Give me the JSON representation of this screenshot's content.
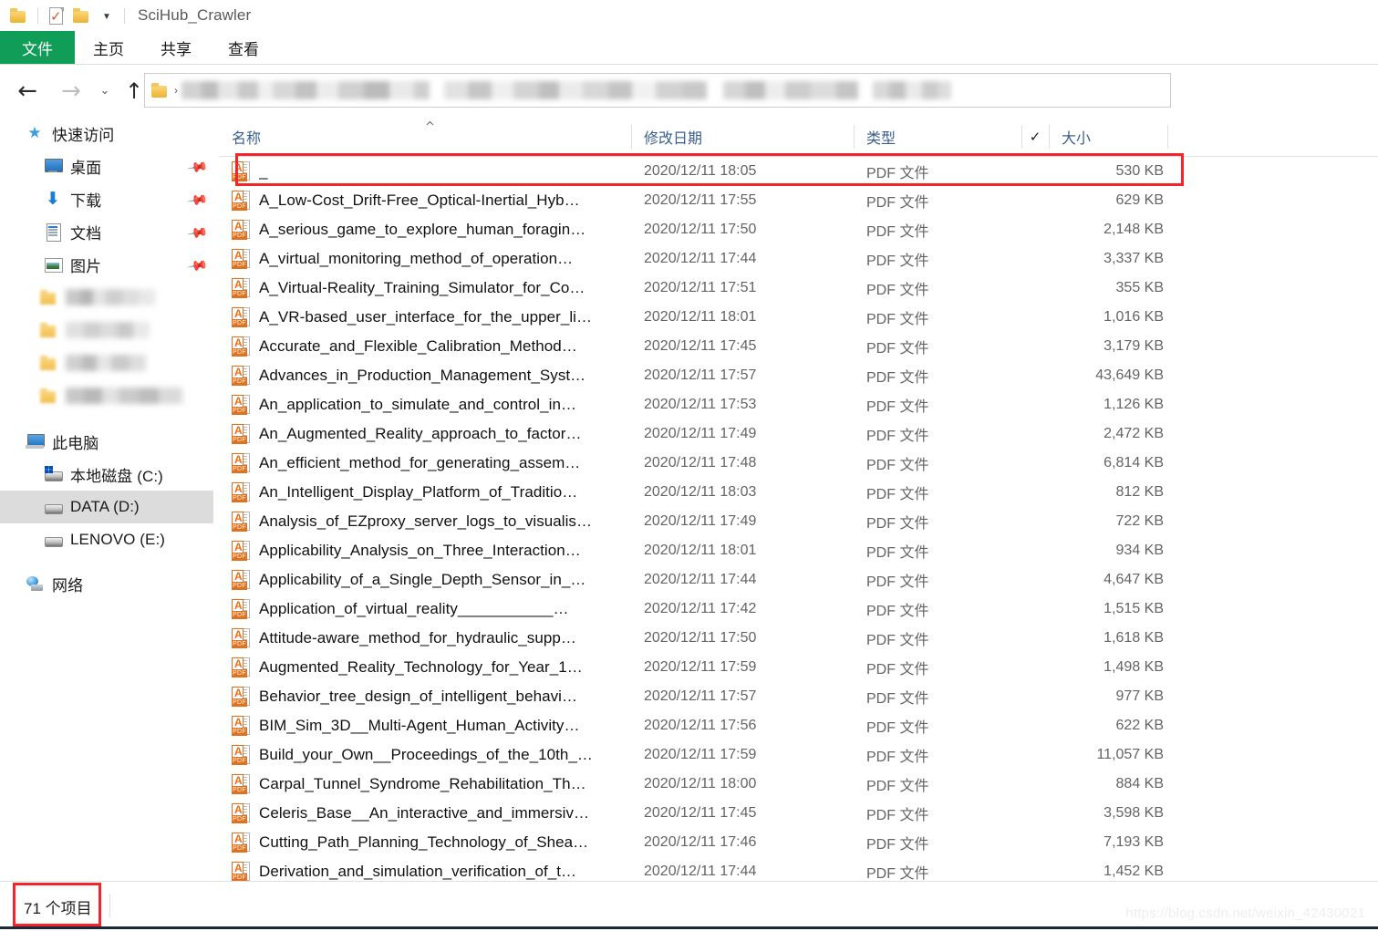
{
  "window": {
    "title": "SciHub_Crawler",
    "quick_access_toolbar": [
      {
        "name": "folder-icon",
        "label": ""
      },
      {
        "name": "properties-icon",
        "label": ""
      },
      {
        "name": "new-folder-icon",
        "label": ""
      },
      {
        "name": "customize-caret-icon",
        "label": "▼"
      }
    ]
  },
  "ribbon": {
    "tabs": [
      {
        "label": "文件",
        "active": true
      },
      {
        "label": "主页",
        "active": false
      },
      {
        "label": "共享",
        "active": false
      },
      {
        "label": "查看",
        "active": false
      }
    ]
  },
  "nav": {
    "back": "←",
    "forward": "→",
    "recent": "⌄",
    "up": "↑",
    "address_chevron": "›",
    "address_redacted": true
  },
  "sidebar": {
    "quick_access": {
      "label": "快速访问"
    },
    "pinned": [
      {
        "label": "桌面",
        "icon": "desktop-icon",
        "pinned": true
      },
      {
        "label": "下载",
        "icon": "download-icon",
        "pinned": true
      },
      {
        "label": "文档",
        "icon": "documents-icon",
        "pinned": true
      },
      {
        "label": "图片",
        "icon": "pictures-icon",
        "pinned": true
      }
    ],
    "redacted_folders": 4,
    "this_pc": {
      "label": "此电脑"
    },
    "drives": [
      {
        "label": "本地磁盘 (C:)",
        "selected": false
      },
      {
        "label": "DATA (D:)",
        "selected": true
      },
      {
        "label": "LENOVO (E:)",
        "selected": false
      }
    ],
    "network": {
      "label": "网络"
    }
  },
  "columns": {
    "name": "名称",
    "date_modified": "修改日期",
    "type": "类型",
    "checkmark": "✓",
    "size": "大小",
    "sort_indicator": "^"
  },
  "files": [
    {
      "name": "_",
      "date": "2020/12/11 18:05",
      "type": "PDF 文件",
      "size": "530 KB",
      "highlighted": true
    },
    {
      "name": "A_Low-Cost_Drift-Free_Optical-Inertial_Hyb…",
      "date": "2020/12/11 17:55",
      "type": "PDF 文件",
      "size": "629 KB",
      "highlighted": false
    },
    {
      "name": "A_serious_game_to_explore_human_foragin…",
      "date": "2020/12/11 17:50",
      "type": "PDF 文件",
      "size": "2,148 KB",
      "highlighted": false
    },
    {
      "name": "A_virtual_monitoring_method_of_operation…",
      "date": "2020/12/11 17:44",
      "type": "PDF 文件",
      "size": "3,337 KB",
      "highlighted": false
    },
    {
      "name": "A_Virtual-Reality_Training_Simulator_for_Co…",
      "date": "2020/12/11 17:51",
      "type": "PDF 文件",
      "size": "355 KB",
      "highlighted": false
    },
    {
      "name": "A_VR-based_user_interface_for_the_upper_li…",
      "date": "2020/12/11 18:01",
      "type": "PDF 文件",
      "size": "1,016 KB",
      "highlighted": false
    },
    {
      "name": "Accurate_and_Flexible_Calibration_Method…",
      "date": "2020/12/11 17:45",
      "type": "PDF 文件",
      "size": "3,179 KB",
      "highlighted": false
    },
    {
      "name": "Advances_in_Production_Management_Syst…",
      "date": "2020/12/11 17:57",
      "type": "PDF 文件",
      "size": "43,649 KB",
      "highlighted": false
    },
    {
      "name": "An_application_to_simulate_and_control_in…",
      "date": "2020/12/11 17:53",
      "type": "PDF 文件",
      "size": "1,126 KB",
      "highlighted": false
    },
    {
      "name": "An_Augmented_Reality_approach_to_factor…",
      "date": "2020/12/11 17:49",
      "type": "PDF 文件",
      "size": "2,472 KB",
      "highlighted": false
    },
    {
      "name": "An_efficient_method_for_generating_assem…",
      "date": "2020/12/11 17:48",
      "type": "PDF 文件",
      "size": "6,814 KB",
      "highlighted": false
    },
    {
      "name": "An_Intelligent_Display_Platform_of_Traditio…",
      "date": "2020/12/11 18:03",
      "type": "PDF 文件",
      "size": "812 KB",
      "highlighted": false
    },
    {
      "name": "Analysis_of_EZproxy_server_logs_to_visualis…",
      "date": "2020/12/11 17:49",
      "type": "PDF 文件",
      "size": "722 KB",
      "highlighted": false
    },
    {
      "name": "Applicability_Analysis_on_Three_Interaction…",
      "date": "2020/12/11 18:01",
      "type": "PDF 文件",
      "size": "934 KB",
      "highlighted": false
    },
    {
      "name": "Applicability_of_a_Single_Depth_Sensor_in_…",
      "date": "2020/12/11 17:44",
      "type": "PDF 文件",
      "size": "4,647 KB",
      "highlighted": false
    },
    {
      "name": "Application_of_virtual_reality___________…",
      "date": "2020/12/11 17:42",
      "type": "PDF 文件",
      "size": "1,515 KB",
      "highlighted": false
    },
    {
      "name": "Attitude-aware_method_for_hydraulic_supp…",
      "date": "2020/12/11 17:50",
      "type": "PDF 文件",
      "size": "1,618 KB",
      "highlighted": false
    },
    {
      "name": "Augmented_Reality_Technology_for_Year_1…",
      "date": "2020/12/11 17:59",
      "type": "PDF 文件",
      "size": "1,498 KB",
      "highlighted": false
    },
    {
      "name": "Behavior_tree_design_of_intelligent_behavi…",
      "date": "2020/12/11 17:57",
      "type": "PDF 文件",
      "size": "977 KB",
      "highlighted": false
    },
    {
      "name": "BIM_Sim_3D__Multi-Agent_Human_Activity…",
      "date": "2020/12/11 17:56",
      "type": "PDF 文件",
      "size": "622 KB",
      "highlighted": false
    },
    {
      "name": "Build_your_Own__Proceedings_of_the_10th_…",
      "date": "2020/12/11 17:59",
      "type": "PDF 文件",
      "size": "11,057 KB",
      "highlighted": false
    },
    {
      "name": "Carpal_Tunnel_Syndrome_Rehabilitation_Th…",
      "date": "2020/12/11 18:00",
      "type": "PDF 文件",
      "size": "884 KB",
      "highlighted": false
    },
    {
      "name": "Celeris_Base__An_interactive_and_immersiv…",
      "date": "2020/12/11 17:45",
      "type": "PDF 文件",
      "size": "3,598 KB",
      "highlighted": false
    },
    {
      "name": "Cutting_Path_Planning_Technology_of_Shea…",
      "date": "2020/12/11 17:46",
      "type": "PDF 文件",
      "size": "7,193 KB",
      "highlighted": false
    },
    {
      "name": "Derivation_and_simulation_verification_of_t…",
      "date": "2020/12/11 17:44",
      "type": "PDF 文件",
      "size": "1,452 KB",
      "highlighted": false
    }
  ],
  "status": {
    "item_count": "71 个项目",
    "highlighted": true
  },
  "watermark": "https://blog.csdn.net/weixin_42430021",
  "colors": {
    "file_tab_green": "#0f9d58",
    "highlight_red": "#f4242a",
    "selection_gray": "#dcdcdc",
    "header_blue": "#3a5f8f",
    "pdf_orange": "#e2711d"
  }
}
